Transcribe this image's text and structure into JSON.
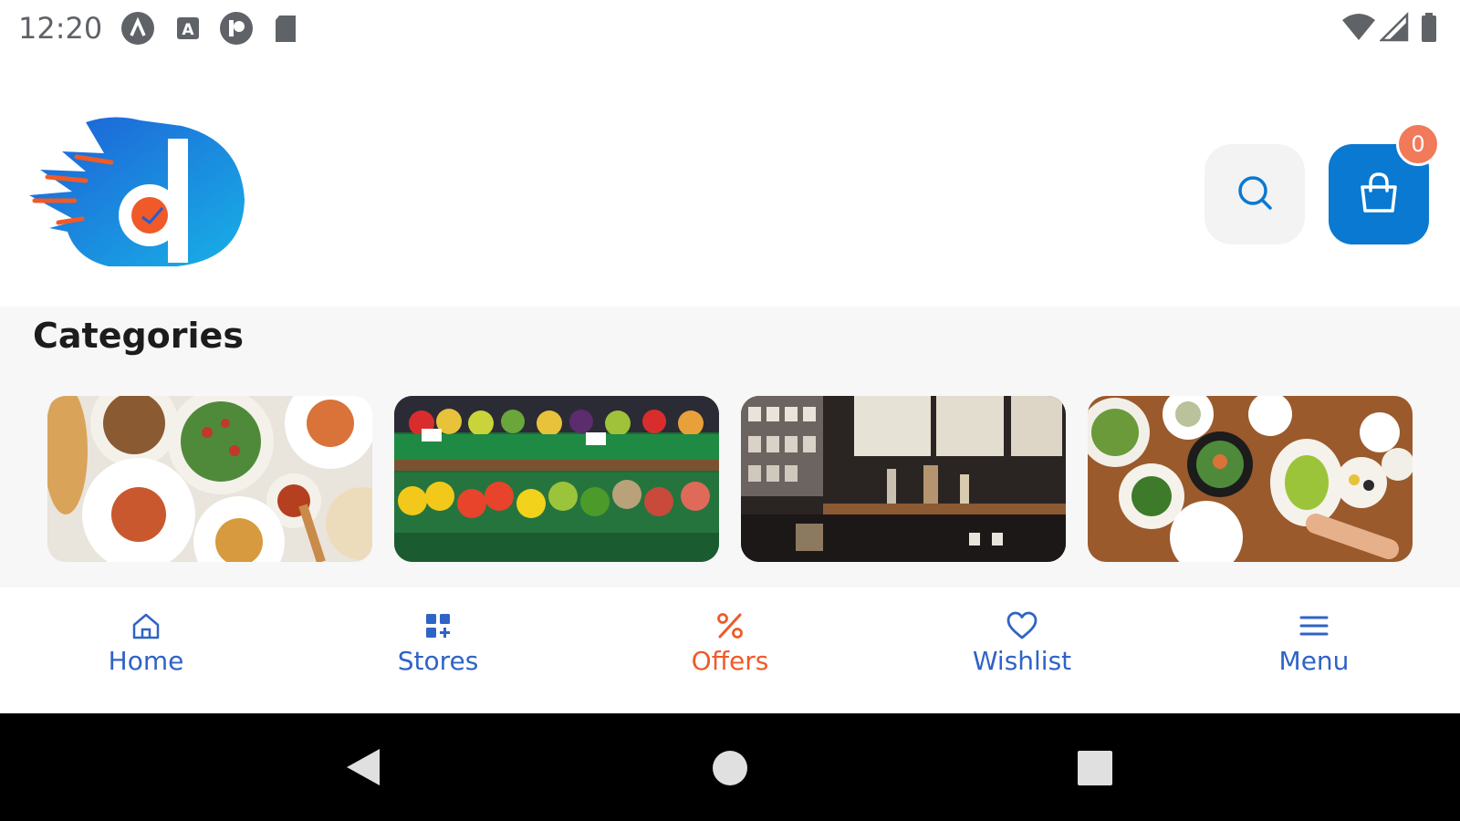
{
  "status_bar": {
    "time": "12:20",
    "left_icons": [
      "assistant-icon",
      "a-badge-icon",
      "p-icon",
      "sd-card-icon"
    ],
    "right_icons": [
      "wifi-icon",
      "signal-icon",
      "battery-icon"
    ]
  },
  "header": {
    "logo": "d",
    "cart_count": "0"
  },
  "categories": {
    "title": "Categories",
    "items": [
      {
        "image": "pasta-dishes"
      },
      {
        "image": "vegetable-market"
      },
      {
        "image": "coffee-shop"
      },
      {
        "image": "dining-table"
      }
    ]
  },
  "bottom_nav": {
    "items": [
      {
        "label": "Home",
        "icon": "home-icon",
        "active": false
      },
      {
        "label": "Stores",
        "icon": "grid-icon",
        "active": false
      },
      {
        "label": "Offers",
        "icon": "percent-icon",
        "active": true
      },
      {
        "label": "Wishlist",
        "icon": "heart-icon",
        "active": false
      },
      {
        "label": "Menu",
        "icon": "menu-icon",
        "active": false
      }
    ]
  },
  "colors": {
    "accent": "#0a79d1",
    "active": "#f05a28",
    "inactive": "#2f63c6",
    "badge": "#f07a5a"
  }
}
